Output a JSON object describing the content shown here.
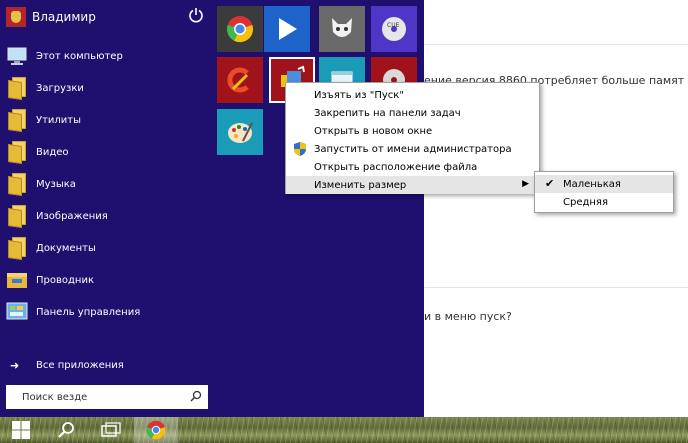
{
  "background_page": {
    "line1_text": "ение версия 8860 потребляет больше памят",
    "line2_text": "и в меню пуск?"
  },
  "user": {
    "name": "Владимир"
  },
  "apps": [
    {
      "label": "Этот компьютер",
      "icon": "computer-icon"
    },
    {
      "label": "Загрузки",
      "icon": "folder-icon"
    },
    {
      "label": "Утилиты",
      "icon": "folder-icon"
    },
    {
      "label": "Видео",
      "icon": "folder-icon"
    },
    {
      "label": "Музыка",
      "icon": "folder-icon"
    },
    {
      "label": "Изображения",
      "icon": "folder-icon"
    },
    {
      "label": "Документы",
      "icon": "folder-icon"
    },
    {
      "label": "Проводник",
      "icon": "explorer-icon"
    },
    {
      "label": "Панель управления",
      "icon": "control-panel-icon"
    }
  ],
  "all_apps_label": "Все приложения",
  "search": {
    "placeholder": "Поиск везде"
  },
  "tiles": [
    {
      "name": "chrome",
      "color": "#3b3b3b"
    },
    {
      "name": "media-player",
      "color": "#1e63c9"
    },
    {
      "name": "foobar",
      "color": "#6a6a6a"
    },
    {
      "name": "cue-disc",
      "color": "#4f36c7"
    },
    {
      "name": "ccleaner",
      "color": "#a1131a"
    },
    {
      "name": "shield-app",
      "color": "#a1131a"
    },
    {
      "name": "window-app",
      "color": "#1a9bb8"
    },
    {
      "name": "disc-app",
      "color": "#a1131a"
    },
    {
      "name": "paint",
      "color": "#1a9bb8"
    }
  ],
  "context_menu": {
    "items": [
      {
        "label": "Изъять из \"Пуск\""
      },
      {
        "label": "Закрепить на панели задач"
      },
      {
        "label": "Открыть в новом окне"
      },
      {
        "label": "Запустить от имени администратора"
      },
      {
        "label": "Открыть расположение файла"
      },
      {
        "label": "Изменить размер"
      }
    ]
  },
  "size_submenu": {
    "items": [
      {
        "label": "Маленькая",
        "checked": true
      },
      {
        "label": "Средняя",
        "checked": false
      }
    ]
  },
  "colors": {
    "start_bg": "#1f0f6e",
    "menu_hover": "#e5e5e5"
  }
}
